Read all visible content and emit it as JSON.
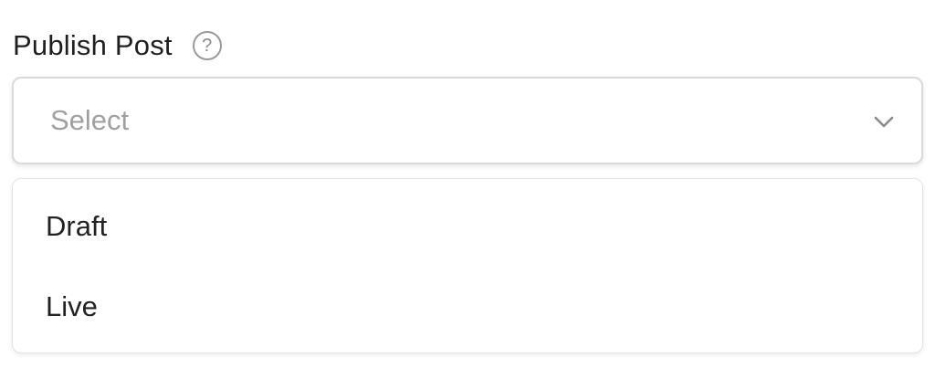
{
  "field": {
    "label": "Publish Post",
    "help_icon": "question-circle-icon",
    "help_glyph": "?"
  },
  "select": {
    "placeholder": "Select",
    "chevron_icon": "chevron-down-icon"
  },
  "dropdown": {
    "options": [
      {
        "label": "Draft"
      },
      {
        "label": "Live"
      }
    ]
  },
  "colors": {
    "label": "#1f1f1f",
    "placeholder": "#a0a0a0",
    "border": "#d9d9d9",
    "icon": "#8c8c8c"
  }
}
